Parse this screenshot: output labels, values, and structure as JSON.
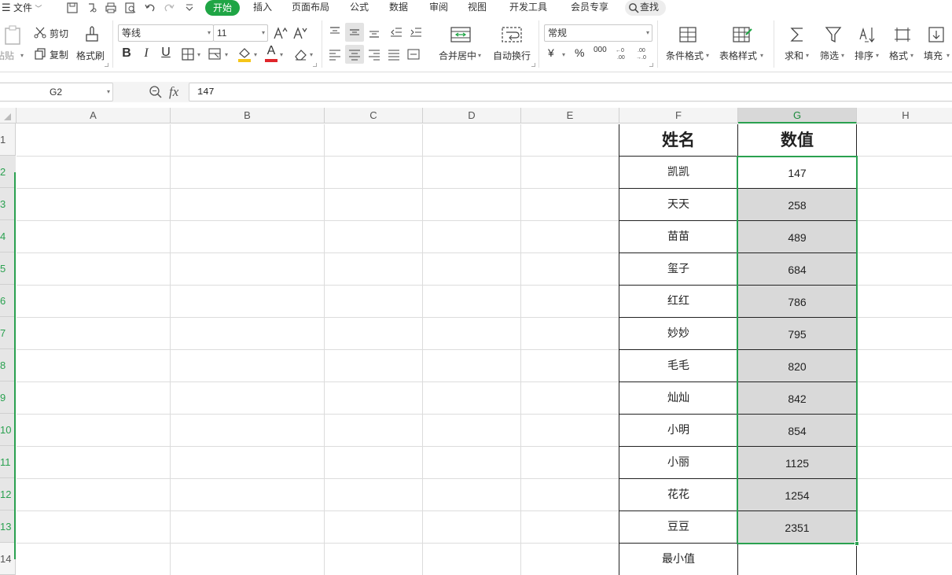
{
  "menu": {
    "file": "文件",
    "tabs": [
      "开始",
      "插入",
      "页面布局",
      "公式",
      "数据",
      "审阅",
      "视图",
      "开发工具",
      "会员专享"
    ],
    "active_tab": "开始",
    "search": "查找"
  },
  "ribbon": {
    "paste": "粘贴",
    "cut": "剪切",
    "copy": "复制",
    "format_painter": "格式刷",
    "font_name": "等线",
    "font_size": "11",
    "bold": "B",
    "italic": "I",
    "underline": "U",
    "font_color_glyph": "A",
    "merge_center": "合并居中",
    "auto_wrap": "自动换行",
    "number_format": "常规",
    "currency": "¥",
    "percent": "%",
    "thousands": "000",
    "cond_format": "条件格式",
    "table_style": "表格样式",
    "sum": "求和",
    "filter": "筛选",
    "sort": "排序",
    "format": "格式",
    "fill": "填充"
  },
  "formula_bar": {
    "cell_ref": "G2",
    "fx": "fx",
    "value": "147"
  },
  "sheet": {
    "columns": [
      "A",
      "B",
      "C",
      "D",
      "E",
      "F",
      "G",
      "H"
    ],
    "selected_column": "G",
    "rows": [
      "1",
      "2",
      "3",
      "4",
      "5",
      "6",
      "7",
      "8",
      "9",
      "10",
      "11",
      "12",
      "13",
      "14"
    ],
    "table": {
      "header_name": "姓名",
      "header_value": "数值",
      "records": [
        {
          "name": "凯凯",
          "value": "147"
        },
        {
          "name": "天天",
          "value": "258"
        },
        {
          "name": "苗苗",
          "value": "489"
        },
        {
          "name": "玺子",
          "value": "684"
        },
        {
          "name": "红红",
          "value": "786"
        },
        {
          "name": "妙妙",
          "value": "795"
        },
        {
          "name": "毛毛",
          "value": "820"
        },
        {
          "name": "灿灿",
          "value": "842"
        },
        {
          "name": "小明",
          "value": "854"
        },
        {
          "name": "小丽",
          "value": "1125"
        },
        {
          "name": "花花",
          "value": "1254"
        },
        {
          "name": "豆豆",
          "value": "2351"
        }
      ],
      "footer_label": "最小值"
    }
  },
  "colors": {
    "accent": "#1fa545",
    "selection_border": "#2aa150",
    "selection_fill": "#d9d9d9"
  }
}
